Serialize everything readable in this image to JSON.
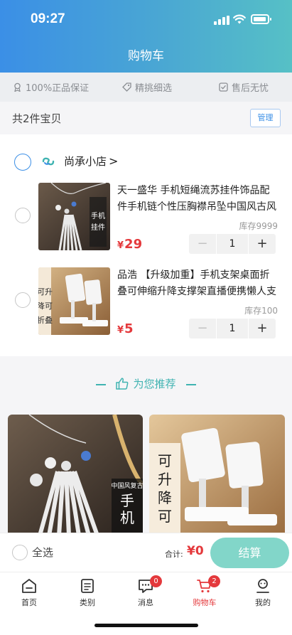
{
  "status_bar": {
    "time": "09:27"
  },
  "header": {
    "title": "购物车"
  },
  "guarantees": [
    {
      "icon": "medal-icon",
      "label": "100%正品保证"
    },
    {
      "icon": "tag-icon",
      "label": "精挑细选"
    },
    {
      "icon": "check-square-icon",
      "label": "售后无忧"
    }
  ],
  "cart": {
    "count_text": "共2件宝贝",
    "manage_label": "管理"
  },
  "shop": {
    "name": "尚承小店",
    "chevron": ">"
  },
  "items": [
    {
      "title": "天一盛华 手机短绳流苏挂件饰品配件手机链个性压胸襟吊坠中国风古风挂绳",
      "stock": "库存9999",
      "currency": "¥",
      "price": "29",
      "quantity": "1",
      "thumb_text": "中国风复古流苏 手机挂件"
    },
    {
      "title": "品浩 【升级加重】手机支架桌面折叠可伸缩升降支撑架直播便携懒人支架",
      "stock": "库存100",
      "currency": "¥",
      "price": "5",
      "quantity": "1",
      "thumb_text": "可升降可折叠"
    }
  ],
  "recommend": {
    "title": "为您推荐"
  },
  "rec_cards": [
    {
      "text": "中国风复古流苏 手机挂件"
    },
    {
      "text": "可升降可折叠 手机平板"
    }
  ],
  "checkout": {
    "select_all": "全选",
    "total_label": "合计:",
    "total_value": "¥0",
    "pay_label": "结算"
  },
  "tabs": [
    {
      "label": "首页",
      "icon": "home-icon"
    },
    {
      "label": "类别",
      "icon": "list-icon"
    },
    {
      "label": "消息",
      "icon": "message-icon",
      "badge": "0"
    },
    {
      "label": "购物车",
      "icon": "cart-icon",
      "badge": "2",
      "active": true
    },
    {
      "label": "我的",
      "icon": "user-icon"
    }
  ],
  "colors": {
    "accent": "#3b8fe6",
    "teal": "#3fb3b1",
    "price_red": "#e4393c",
    "pay_button": "#82d6c9"
  }
}
